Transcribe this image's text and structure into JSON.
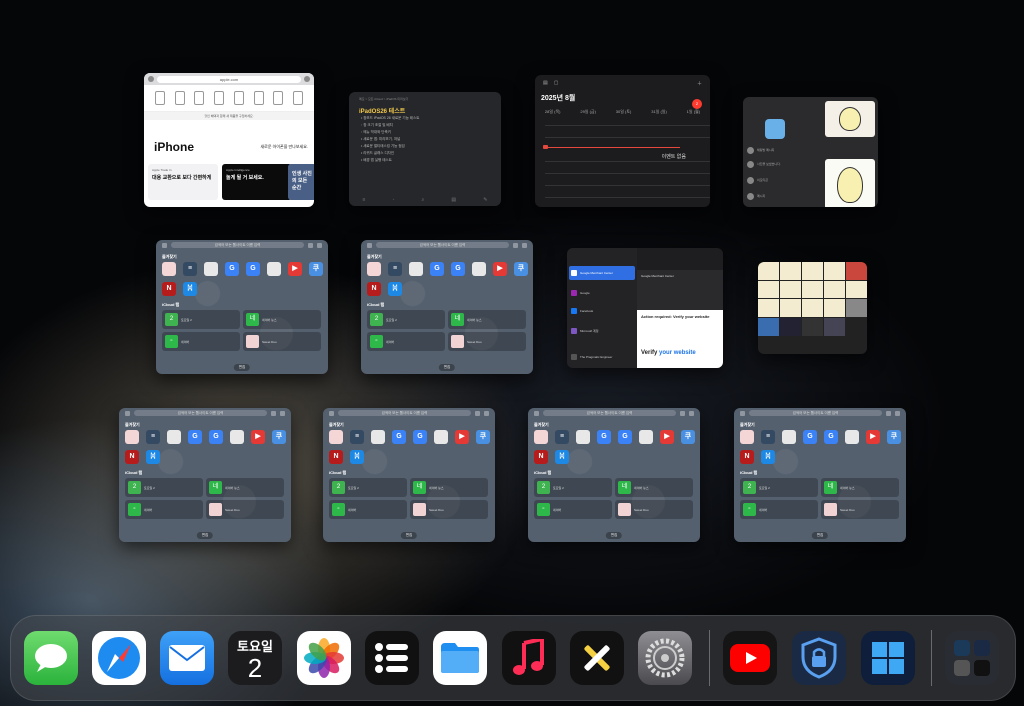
{
  "safari_window": {
    "address": "apple.com",
    "promo": "할인 혜택과 함께 새 제품을 구입하세요.",
    "hero_title": "iPhone",
    "hero_sub": "새로운 아이폰을 만나보세요.",
    "cards": [
      {
        "t1": "Apple Trade In",
        "t2": "대용 교환으로 보다 간편하게"
      },
      {
        "t1": "Apple Intelligence",
        "t2": "놀게 될 거 보세요."
      },
      {
        "t1": "",
        "t2": "인생 사진의 모든 순간"
      }
    ]
  },
  "notes_window": {
    "crumb": "메모 > 모든 iCloud > iPadOS 미리보기",
    "title": "iPadOS26 테스트",
    "lines": [
      "• 창모드 iPadOS 26 새로운 기능 테스트",
      "   ◦ 창 크기 조절 및 배치",
      "   ◦ 메뉴 막대와 단축키",
      "• 새로운 앱: 미리보기, 저널",
      "• 새로운 멀티태스킹 기능 점검",
      "• 리퀴드 글래스 디자인",
      "• 배경 앱 실행 테스트"
    ],
    "tools": [
      "≡",
      "◦",
      "⌕",
      "▤",
      "✎"
    ]
  },
  "calendar_window": {
    "title": "2025년 8월",
    "days": [
      "28일 (목)",
      "29일 (금)",
      "30일 (토)",
      "31일 (일)",
      "1일 (월)"
    ],
    "badge": "2",
    "no_events": "이벤트 없음"
  },
  "kakao_window": {
    "rows": [
      {
        "name": "친구1",
        "msg": "채팅방 메시지"
      },
      {
        "name": "친구2",
        "msg": "사진을 보냈습니다."
      },
      {
        "name": "친구3",
        "msg": "이모티콘"
      },
      {
        "name": "친구4",
        "msg": "메시지"
      }
    ]
  },
  "start_page": {
    "address": "검색어 또는 웹사이트 이름 입력",
    "favorites_label": "즐겨찾기",
    "icloud_label": "iCloud 탭",
    "edit_label": "편집",
    "favorite_icons": [
      {
        "glyph": "",
        "color": "#f4d6d6"
      },
      {
        "glyph": "≡",
        "color": "#344a63"
      },
      {
        "glyph": "",
        "color": "#e8e8e8"
      },
      {
        "glyph": "G",
        "color": "#3b82f6"
      },
      {
        "glyph": "G",
        "color": "#3b82f6"
      },
      {
        "glyph": "",
        "color": "#e8e8e8"
      },
      {
        "glyph": "▶",
        "color": "#e53935"
      },
      {
        "glyph": "쿠",
        "color": "#4a90e2"
      },
      {
        "glyph": "N",
        "color": "#b71c1c"
      },
      {
        "glyph": "ᛞ",
        "color": "#1e88e5"
      }
    ],
    "tiles": [
      {
        "glyph": "2",
        "color": "#3fb34f",
        "text": "토요일 2"
      },
      {
        "glyph": "네",
        "color": "#2eb84a",
        "text": "네이버 뉴스"
      },
      {
        "glyph": "▫",
        "color": "#2eb84a",
        "text": "네이버"
      },
      {
        "glyph": "",
        "color": "#f1d3d3",
        "text": "Sweet Duo"
      }
    ]
  },
  "mail_window": {
    "items": [
      {
        "title": "Google Merchant Center",
        "color": "#4285f4"
      },
      {
        "title": "Google",
        "color": "#9c27b0"
      },
      {
        "title": "Facebook",
        "color": "#1877f2"
      },
      {
        "title": "Microsoft 계정",
        "color": "#7e57c2"
      },
      {
        "title": "The Pragmatic Engineer",
        "color": "#333"
      }
    ],
    "action": "Action required: Verify your website",
    "verify": "Verify",
    "verify_rest": "your website",
    "sender": "Google Merchant Center"
  },
  "dock": {
    "calendar_day": "토요일",
    "calendar_date": "2"
  }
}
